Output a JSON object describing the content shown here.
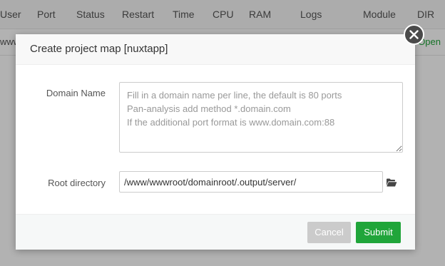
{
  "background_table": {
    "columns": [
      "User",
      "Port",
      "Status",
      "Restart",
      "Time",
      "CPU",
      "RAM",
      "Logs",
      "Module",
      "DIR"
    ],
    "row_left_text": "www",
    "row_right_text": "Open"
  },
  "dialog": {
    "title": "Create project map [nuxtapp]",
    "close_icon": "close-icon",
    "domain": {
      "label": "Domain Name",
      "placeholder": "Fill in a domain name per line, the default is 80 ports\nPan-analysis add method *.domain.com\nIf the additional port format is www.domain.com:88",
      "value": ""
    },
    "root_dir": {
      "label": "Root directory",
      "value": "/www/wwwroot/domainroot/.output/server/",
      "icon": "folder-open-icon"
    },
    "buttons": {
      "cancel": "Cancel",
      "submit": "Submit"
    }
  },
  "colors": {
    "accent": "#20a53a",
    "cancel": "#cbcbcb",
    "overlay": "rgba(0,0,0,0.3)"
  }
}
